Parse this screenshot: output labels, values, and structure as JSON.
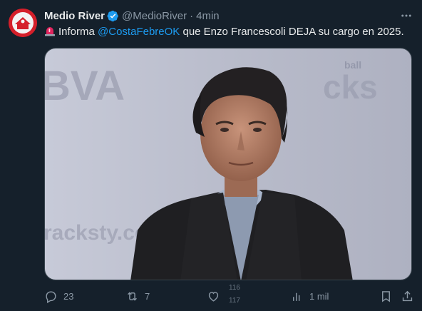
{
  "tweet": {
    "author_name": "Medio River",
    "author_handle": "@MedioRiver",
    "separator": "·",
    "time": "4min",
    "text_lead": "Informa ",
    "mention": "@CostaFebreOK",
    "text_rest": " que Enzo Francescoli DEJA su cargo en 2025.",
    "media_background_text_left": "BVA",
    "media_background_text_right": "cks",
    "media_background_text_top": "ball",
    "media_background_text_bottom": "racksty.com"
  },
  "actions": {
    "replies": "23",
    "reposts": "7",
    "likes_top": "116",
    "likes_bottom": "117",
    "views": "1 mil"
  },
  "colors": {
    "background": "#15202b",
    "accent": "#1d9bf0",
    "muted": "#8b98a5",
    "avatar": "#d51f2a"
  },
  "icons": [
    "verified-badge-icon",
    "more-icon",
    "siren-icon",
    "reply-icon",
    "repost-icon",
    "like-icon",
    "views-icon",
    "bookmark-icon",
    "share-icon"
  ]
}
